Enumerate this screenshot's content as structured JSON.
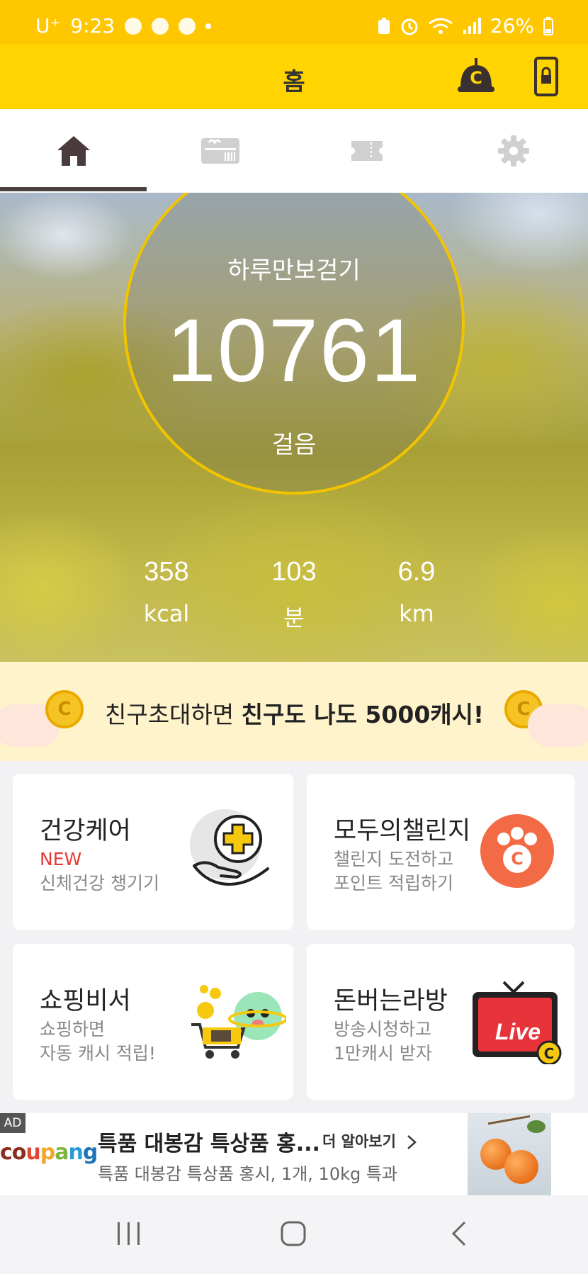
{
  "status_bar": {
    "carrier": "U⁺",
    "time": "9:23",
    "battery": "26%"
  },
  "app_bar": {
    "title": "홈"
  },
  "tabs": [
    {
      "name": "home",
      "icon": "home-icon",
      "active": true
    },
    {
      "name": "gift",
      "icon": "gift-card-icon",
      "active": false
    },
    {
      "name": "ticket",
      "icon": "ticket-icon",
      "active": false
    },
    {
      "name": "settings",
      "icon": "gear-icon",
      "active": false
    }
  ],
  "pedometer": {
    "title": "하루만보걷기",
    "steps": "10761",
    "steps_unit": "걸음",
    "stats": [
      {
        "value": "358",
        "unit": "kcal"
      },
      {
        "value": "103",
        "unit": "분"
      },
      {
        "value": "6.9",
        "unit": "km"
      }
    ]
  },
  "invite_banner": {
    "text_prefix": "친구초대하면 ",
    "text_bold": "친구도 나도 5000캐시!",
    "coin_symbol": "C"
  },
  "cards": [
    {
      "title": "건강케어",
      "badge": "NEW",
      "line1": "신체건강 챙기기",
      "line2": ""
    },
    {
      "title": "모두의챌린지",
      "badge": "",
      "line1": "챌린지 도전하고",
      "line2": "포인트 적립하기"
    },
    {
      "title": "쇼핑비서",
      "badge": "",
      "line1": "쇼핑하면",
      "line2": "자동 캐시 적립!"
    },
    {
      "title": "돈버는라방",
      "badge": "",
      "line1": "방송시청하고",
      "line2": "1만캐시 받자"
    }
  ],
  "live_badge": "Live",
  "ad": {
    "tag": "AD",
    "brand": [
      "co",
      "u",
      "p",
      "a",
      "n",
      "g"
    ],
    "title": "특품 대봉감 특상품 홍...",
    "more": "더 알아보기",
    "subtitle": "특품 대봉감 특상품 홍시, 1개, 10kg 특과"
  },
  "colors": {
    "primary": "#ffd400",
    "status": "#ffc700",
    "accent_red": "#e53935",
    "banner_bg": "#fff3cc"
  }
}
